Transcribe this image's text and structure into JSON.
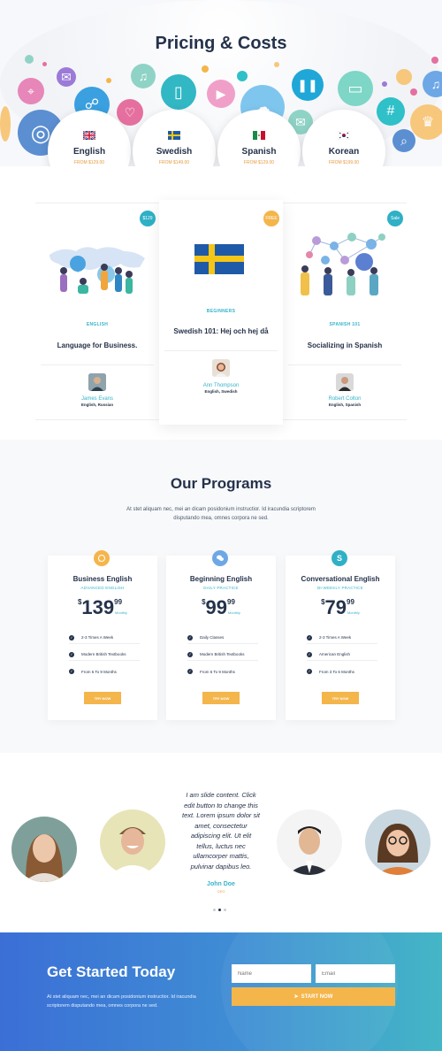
{
  "hero": {
    "title": "Pricing & Costs",
    "languages": [
      {
        "name": "English",
        "price": "FROM $129.00"
      },
      {
        "name": "Swedish",
        "price": "FROM $149.00"
      },
      {
        "name": "Spanish",
        "price": "FROM $129.00"
      },
      {
        "name": "Korean",
        "price": "FROM $199.00"
      }
    ]
  },
  "courses": [
    {
      "badge": "$129",
      "category": "ENGLISH",
      "title": "Language for Business.",
      "teacher": "James Evans",
      "langs": "English, Russian"
    },
    {
      "badge": "FREE",
      "category": "BEGINNERS",
      "title": "Swedish 101: Hej och hej då",
      "teacher": "Ann Thompson",
      "langs": "English, Swedish"
    },
    {
      "badge": "Sale",
      "category": "SPANISH 101",
      "title": "Socializing in Spanish",
      "teacher": "Robert Colton",
      "langs": "English, Spanish"
    }
  ],
  "programs": {
    "title": "Our Programs",
    "subtitle": "At stet aliquam nec, mei an dicam posidonium instructior. Id iracundia scriptorem disputando mea, omnes corpora ne sed.",
    "plans": [
      {
        "name": "Business English",
        "tag": "ADVANCED ENGLISH",
        "currency": "$",
        "price": "139",
        "cents": "99",
        "period": "Monthly",
        "features": [
          "2-3 Times A Week",
          "Modern British Textbooks",
          "From 6 To 9 Months"
        ],
        "button": "TRY NOW"
      },
      {
        "name": "Beginning English",
        "tag": "DAILY PRACTICE",
        "currency": "$",
        "price": "99",
        "cents": "99",
        "period": "Monthly",
        "features": [
          "Daily Classes",
          "Modern British Textbooks",
          "From 6 To 9 Months"
        ],
        "button": "TRY NOW"
      },
      {
        "name": "Conversational English",
        "tag": "BI-WEEKLY PRACTICE",
        "currency": "$",
        "price": "79",
        "cents": "99",
        "period": "Monthly",
        "features": [
          "2-3 Times A Week",
          "American English",
          "From 3 To 6 Months"
        ],
        "button": "TRY NOW"
      }
    ]
  },
  "testimonial": {
    "quote": "I am slide content. Click edit button to change this text. Lorem ipsum dolor sit amet, consectetur adipiscing elit. Ut elit tellus, luctus nec ullamcorper mattis, pulvinar dapibus leo.",
    "name": "John Doe",
    "role": "CEO"
  },
  "cta": {
    "title": "Get Started Today",
    "text": "At stet aliquam nec, mei an dicam posidonium instructior. Id iracundia scriptorem disputando mea, omnes corpora ne sed.",
    "name_placeholder": "Name",
    "email_placeholder": "Email",
    "button": "START NOW"
  },
  "colors": {
    "accent": "#36b3c9",
    "button": "#f4b54b",
    "heading": "#25324a"
  }
}
